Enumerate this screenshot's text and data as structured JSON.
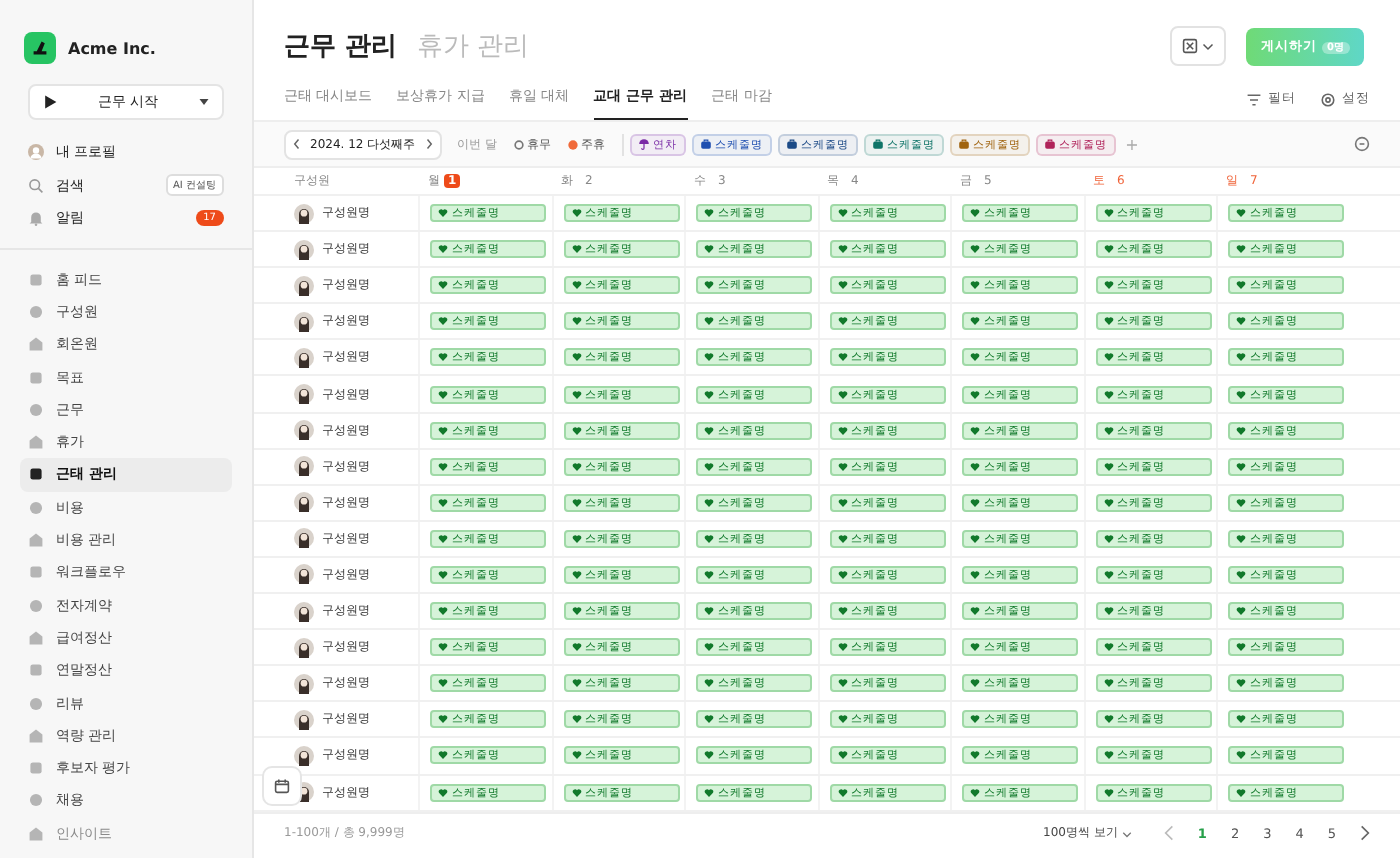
{
  "company": {
    "name": "Acme Inc."
  },
  "start_button": {
    "label": "근무 시작"
  },
  "quick_items": [
    {
      "kind": "profile",
      "label": "내 프로필"
    },
    {
      "kind": "search",
      "label": "검색",
      "tag": "AI 컨설팅"
    },
    {
      "kind": "alarm",
      "label": "알림",
      "badge": "17"
    }
  ],
  "nav_items": [
    {
      "label": "홈 피드",
      "selected": false,
      "disabled": false
    },
    {
      "label": "구성원",
      "selected": false,
      "disabled": false
    },
    {
      "label": "회온원",
      "selected": false,
      "disabled": false
    },
    {
      "label": "목표",
      "selected": false,
      "disabled": false
    },
    {
      "label": "근무",
      "selected": false,
      "disabled": false
    },
    {
      "label": "휴가",
      "selected": false,
      "disabled": false
    },
    {
      "label": "근태 관리",
      "selected": true,
      "disabled": false
    },
    {
      "label": "비용",
      "selected": false,
      "disabled": false
    },
    {
      "label": "비용 관리",
      "selected": false,
      "disabled": false
    },
    {
      "label": "워크플로우",
      "selected": false,
      "disabled": false
    },
    {
      "label": "전자계약",
      "selected": false,
      "disabled": false
    },
    {
      "label": "급여정산",
      "selected": false,
      "disabled": false
    },
    {
      "label": "연말정산",
      "selected": false,
      "disabled": false
    },
    {
      "label": "리뷰",
      "selected": false,
      "disabled": false
    },
    {
      "label": "역량 관리",
      "selected": false,
      "disabled": false
    },
    {
      "label": "후보자 평가",
      "selected": false,
      "disabled": false
    },
    {
      "label": "채용",
      "selected": false,
      "disabled": false
    },
    {
      "label": "인사이트",
      "selected": false,
      "disabled": true
    }
  ],
  "page_titles": [
    {
      "label": "근무 관리",
      "selected": true
    },
    {
      "label": "휴가 관리",
      "selected": false
    }
  ],
  "publish_button": {
    "label": "게시하기",
    "badge": "0명"
  },
  "tabs": [
    {
      "label": "근태 대시보드",
      "selected": false
    },
    {
      "label": "보상휴가 지급",
      "selected": false
    },
    {
      "label": "휴일 대체",
      "selected": false
    },
    {
      "label": "교대 근무 관리",
      "selected": true
    },
    {
      "label": "근태 마감",
      "selected": false
    }
  ],
  "tab_actions": [
    {
      "kind": "filter",
      "label": "필터"
    },
    {
      "kind": "settings",
      "label": "설정"
    }
  ],
  "week_picker": {
    "label": "2024. 12 다섯째주"
  },
  "this_month_button": {
    "label": "이번 달"
  },
  "legend": [
    {
      "kind": "off",
      "label": "휴무"
    },
    {
      "kind": "holiday",
      "label": "주휴"
    }
  ],
  "chips": [
    {
      "kind": "leave",
      "label": "연차",
      "color": "#7a2aa6"
    },
    {
      "kind": "work",
      "label": "스케줄명",
      "color": "#1f4fb0"
    },
    {
      "kind": "work",
      "label": "스케줄명",
      "color": "#1c4a86"
    },
    {
      "kind": "work",
      "label": "스케줄명",
      "color": "#0f7468"
    },
    {
      "kind": "work",
      "label": "스케줄명",
      "color": "#a06410"
    },
    {
      "kind": "work",
      "label": "스케줄명",
      "color": "#b0235a"
    }
  ],
  "add_chip": "+",
  "table": {
    "member_header": "구성원",
    "days": [
      {
        "name": "월",
        "number": "1",
        "today": true,
        "weekend": false
      },
      {
        "name": "화",
        "number": "2",
        "today": false,
        "weekend": false
      },
      {
        "name": "수",
        "number": "3",
        "today": false,
        "weekend": false
      },
      {
        "name": "목",
        "number": "4",
        "today": false,
        "weekend": false
      },
      {
        "name": "금",
        "number": "5",
        "today": false,
        "weekend": false
      },
      {
        "name": "토",
        "number": "6",
        "today": false,
        "weekend": true
      },
      {
        "name": "일",
        "number": "7",
        "today": false,
        "weekend": true
      }
    ],
    "rows": [
      {
        "name": "구성원명",
        "cells": [
          "스케줄명",
          "스케줄명",
          "스케줄명",
          "스케줄명",
          "스케줄명",
          "스케줄명",
          "스케줄명"
        ]
      },
      {
        "name": "구성원명",
        "cells": [
          "스케줄명",
          "스케줄명",
          "스케줄명",
          "스케줄명",
          "스케줄명",
          "스케줄명",
          "스케줄명"
        ]
      },
      {
        "name": "구성원명",
        "cells": [
          "스케줄명",
          "스케줄명",
          "스케줄명",
          "스케줄명",
          "스케줄명",
          "스케줄명",
          "스케줄명"
        ]
      },
      {
        "name": "구성원명",
        "cells": [
          "스케줄명",
          "스케줄명",
          "스케줄명",
          "스케줄명",
          "스케줄명",
          "스케줄명",
          "스케줄명"
        ]
      },
      {
        "name": "구성원명",
        "cells": [
          "스케줄명",
          "스케줄명",
          "스케줄명",
          "스케줄명",
          "스케줄명",
          "스케줄명",
          "스케줄명"
        ]
      },
      {
        "name": "구성원명",
        "cells": [
          "스케줄명",
          "스케줄명",
          "스케줄명",
          "스케줄명",
          "스케줄명",
          "스케줄명",
          "스케줄명"
        ]
      },
      {
        "name": "구성원명",
        "cells": [
          "스케줄명",
          "스케줄명",
          "스케줄명",
          "스케줄명",
          "스케줄명",
          "스케줄명",
          "스케줄명"
        ]
      },
      {
        "name": "구성원명",
        "cells": [
          "스케줄명",
          "스케줄명",
          "스케줄명",
          "스케줄명",
          "스케줄명",
          "스케줄명",
          "스케줄명"
        ]
      },
      {
        "name": "구성원명",
        "cells": [
          "스케줄명",
          "스케줄명",
          "스케줄명",
          "스케줄명",
          "스케줄명",
          "스케줄명",
          "스케줄명"
        ]
      },
      {
        "name": "구성원명",
        "cells": [
          "스케줄명",
          "스케줄명",
          "스케줄명",
          "스케줄명",
          "스케줄명",
          "스케줄명",
          "스케줄명"
        ]
      },
      {
        "name": "구성원명",
        "cells": [
          "스케줄명",
          "스케줄명",
          "스케줄명",
          "스케줄명",
          "스케줄명",
          "스케줄명",
          "스케줄명"
        ]
      },
      {
        "name": "구성원명",
        "cells": [
          "스케줄명",
          "스케줄명",
          "스케줄명",
          "스케줄명",
          "스케줄명",
          "스케줄명",
          "스케줄명"
        ]
      },
      {
        "name": "구성원명",
        "cells": [
          "스케줄명",
          "스케줄명",
          "스케줄명",
          "스케줄명",
          "스케줄명",
          "스케줄명",
          "스케줄명"
        ]
      },
      {
        "name": "구성원명",
        "cells": [
          "스케줄명",
          "스케줄명",
          "스케줄명",
          "스케줄명",
          "스케줄명",
          "스케줄명",
          "스케줄명"
        ]
      },
      {
        "name": "구성원명",
        "cells": [
          "스케줄명",
          "스케줄명",
          "스케줄명",
          "스케줄명",
          "스케줄명",
          "스케줄명",
          "스케줄명"
        ]
      },
      {
        "name": "구성원명",
        "cells": [
          "스케줄명",
          "스케줄명",
          "스케줄명",
          "스케줄명",
          "스케줄명",
          "스케줄명",
          "스케줄명"
        ]
      },
      {
        "name": "구성원명",
        "cells": [
          "스케줄명",
          "스케줄명",
          "스케줄명",
          "스케줄명",
          "스케줄명",
          "스케줄명",
          "스케줄명"
        ]
      }
    ]
  },
  "footer": {
    "range": "1-100개 / 총 9,999명",
    "page_size": "100명씩 보기",
    "pages": [
      {
        "label": "1",
        "selected": true
      },
      {
        "label": "2",
        "selected": false
      },
      {
        "label": "3",
        "selected": false
      },
      {
        "label": "4",
        "selected": false
      },
      {
        "label": "5",
        "selected": false
      }
    ]
  }
}
